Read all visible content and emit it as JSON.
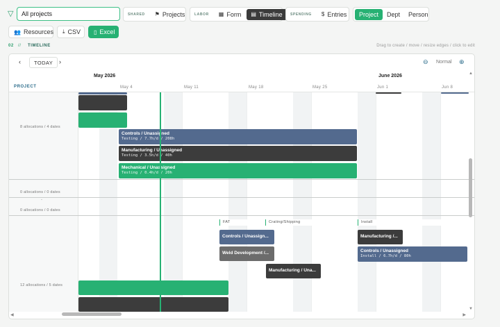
{
  "filter": {
    "search_value": "All projects"
  },
  "shared": {
    "label": "SHARED",
    "projects": "Projects"
  },
  "labor": {
    "label": "LABOR",
    "form": "Form",
    "timeline": "Timeline"
  },
  "spending": {
    "label": "SPENDING",
    "entries": "Entries"
  },
  "groupby": {
    "project": "Project",
    "dept": "Dept",
    "person": "Person"
  },
  "actions": {
    "resources": "Resources",
    "csv": "CSV",
    "excel": "Excel"
  },
  "section": {
    "num": "02",
    "slash": "//",
    "title": "TIMELINE",
    "hint": "Drag to create / move / resize edges / click to edit"
  },
  "toolbar": {
    "prev": "‹",
    "today": "TODAY",
    "next": "›",
    "zoom_label": "Normal"
  },
  "months": [
    "May 2026",
    "June 2026"
  ],
  "weeks": [
    "May 4",
    "May 11",
    "May 18",
    "May 25",
    "Jun 1",
    "Jun 8"
  ],
  "grid": {
    "project_header": "PROJECT"
  },
  "rows": [
    {
      "label": "8 allocations / 4 dates"
    },
    {
      "label": "0 allocations / 0 dates"
    },
    {
      "label": "-"
    },
    {
      "label": "0 allocations / 0 dates"
    },
    {
      "label": "12 allocations / 5 dates"
    }
  ],
  "bars": [
    {
      "title": "Controls / Unassigned",
      "sub": "Testing / 7.7h/d / 208h"
    },
    {
      "title": "Manufacturing / Unassigned",
      "sub": "Testing / 3.5h/d / 40h"
    },
    {
      "title": "Mechanical / Unassigned",
      "sub": "Testing / 0.4h/d / 20h"
    },
    {
      "title": "Controls / Unassign..."
    },
    {
      "title": "Weld Development /..."
    },
    {
      "title": "Manufacturing /..."
    },
    {
      "title": "Controls / Unassigned",
      "sub": "Install / 6.7h/d / 80h"
    },
    {
      "title": "Manufacturing / Una..."
    }
  ],
  "milestones": [
    "FAT",
    "Crating/Shipping",
    "Install"
  ],
  "colors": {
    "accent": "#27b173",
    "dark": "#3c3c3c",
    "blue": "#536a8e"
  }
}
